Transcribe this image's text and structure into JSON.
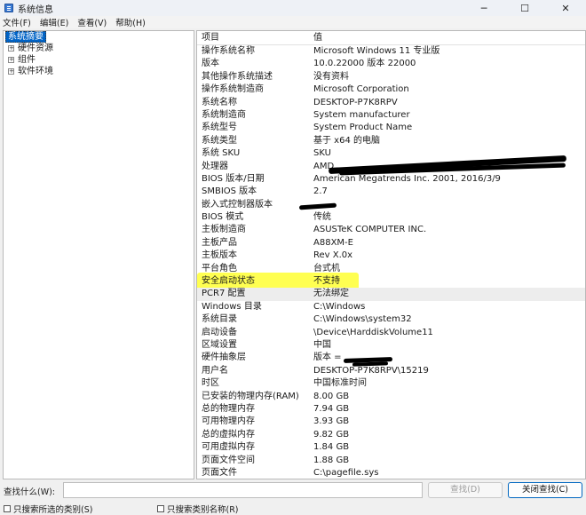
{
  "window": {
    "title": "系统信息"
  },
  "controls": {
    "minimize": "─",
    "maximize": "☐",
    "close": "✕"
  },
  "menu": [
    "文件(F)",
    "编辑(E)",
    "查看(V)",
    "帮助(H)"
  ],
  "tree": {
    "root": "系统摘要",
    "children": [
      {
        "label": "硬件资源",
        "expander": "+"
      },
      {
        "label": "组件",
        "expander": "+"
      },
      {
        "label": "软件环境",
        "expander": "+"
      }
    ]
  },
  "list": {
    "header": {
      "item": "项目",
      "value": "值"
    },
    "rows": [
      {
        "item": "操作系统名称",
        "value": "Microsoft Windows 11 专业版"
      },
      {
        "item": "版本",
        "value": "10.0.22000 版本 22000"
      },
      {
        "item": "其他操作系统描述",
        "value": "没有资料"
      },
      {
        "item": "操作系统制造商",
        "value": "Microsoft Corporation"
      },
      {
        "item": "系统名称",
        "value": "DESKTOP-P7K8RPV"
      },
      {
        "item": "系统制造商",
        "value": "System manufacturer"
      },
      {
        "item": "系统型号",
        "value": "System Product Name"
      },
      {
        "item": "系统类型",
        "value": "基于 x64 的电脑"
      },
      {
        "item": "系统 SKU",
        "value": "SKU"
      },
      {
        "item": "处理器",
        "value": "AMD"
      },
      {
        "item": "BIOS 版本/日期",
        "value": "American Megatrends Inc. 2001, 2016/3/9"
      },
      {
        "item": "SMBIOS 版本",
        "value": "2.7"
      },
      {
        "item": "嵌入式控制器版本",
        "value": ""
      },
      {
        "item": "BIOS 模式",
        "value": "传统"
      },
      {
        "item": "主板制造商",
        "value": "ASUSTeK COMPUTER INC."
      },
      {
        "item": "主板产品",
        "value": "A88XM-E"
      },
      {
        "item": "主板版本",
        "value": "Rev X.0x"
      },
      {
        "item": "平台角色",
        "value": "台式机"
      },
      {
        "item": "安全启动状态",
        "value": "不支持"
      },
      {
        "item": "PCR7 配置",
        "value": "无法绑定"
      },
      {
        "item": "Windows 目录",
        "value": "C:\\Windows"
      },
      {
        "item": "系统目录",
        "value": "C:\\Windows\\system32"
      },
      {
        "item": "启动设备",
        "value": "\\Device\\HarddiskVolume11"
      },
      {
        "item": "区域设置",
        "value": "中国"
      },
      {
        "item": "硬件抽象层",
        "value": "版本 ="
      },
      {
        "item": "用户名",
        "value": "DESKTOP-P7K8RPV\\15219"
      },
      {
        "item": "时区",
        "value": "中国标准时间"
      },
      {
        "item": "已安装的物理内存(RAM)",
        "value": "8.00 GB"
      },
      {
        "item": "总的物理内存",
        "value": "7.94 GB"
      },
      {
        "item": "可用物理内存",
        "value": "3.93 GB"
      },
      {
        "item": "总的虚拟内存",
        "value": "9.82 GB"
      },
      {
        "item": "可用虚拟内存",
        "value": "1.84 GB"
      },
      {
        "item": "页面文件空间",
        "value": "1.88 GB"
      },
      {
        "item": "页面文件",
        "value": "C:\\pagefile.sys"
      }
    ]
  },
  "find": {
    "label": "查找什么(W):",
    "input_value": "",
    "find_button": "查找(D)",
    "close_button": "关闭查找(C)",
    "check_selected": "只搜索所选的类别(S)",
    "check_names": "只搜索类别名称(R)"
  },
  "colors": {
    "selection": "#0063c6",
    "marker": "#ffff33",
    "accent_border": "#0067c0"
  }
}
